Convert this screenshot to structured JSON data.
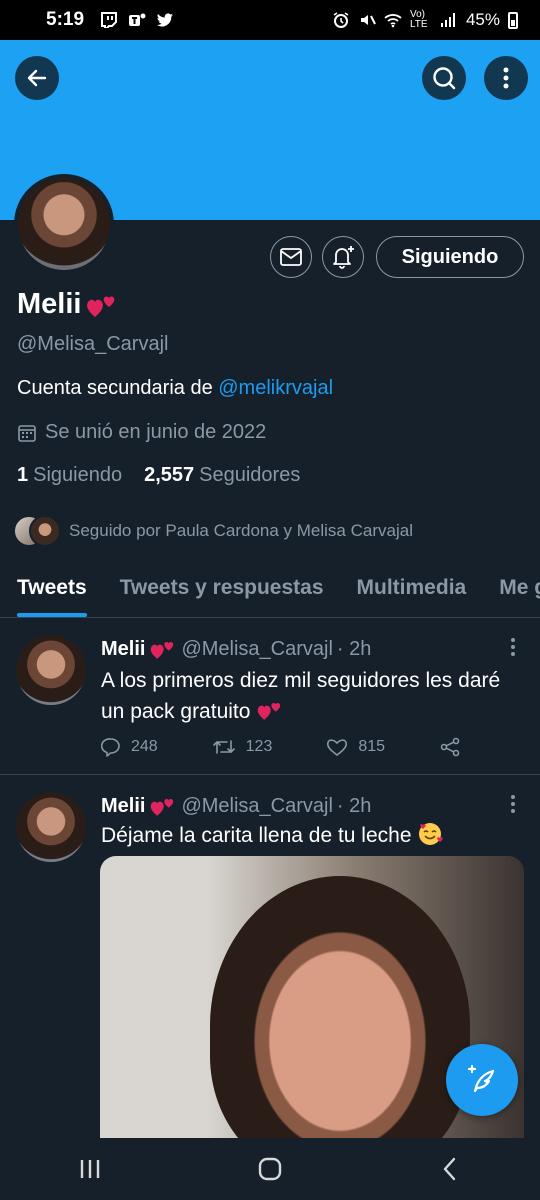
{
  "status_bar": {
    "time": "5:19",
    "battery": "45%",
    "network": "Vo) LTE"
  },
  "profile": {
    "display_name": "Melii",
    "handle": "@Melisa_Carvajl",
    "bio_prefix": "Cuenta secundaria de ",
    "bio_link": "@melikrvajal",
    "joined": "Se unió en junio de 2022",
    "following_count": "1",
    "following_label": "Siguiendo",
    "followers_count": "2,557",
    "followers_label": "Seguidores",
    "followed_by": "Seguido por Paula Cardona y Melisa Carvajal",
    "follow_button": "Siguiendo"
  },
  "tabs": [
    {
      "label": "Tweets",
      "active": true
    },
    {
      "label": "Tweets y respuestas",
      "active": false
    },
    {
      "label": "Multimedia",
      "active": false
    },
    {
      "label": "Me gusta",
      "active": false
    }
  ],
  "tweets": [
    {
      "name": "Melii",
      "handle": "@Melisa_Carvajl",
      "time": "· 2h",
      "text": "A los primeros diez mil seguidores les daré un pack gratuito",
      "replies": "248",
      "retweets": "123",
      "likes": "815"
    },
    {
      "name": "Melii",
      "handle": "@Melisa_Carvajl",
      "time": "· 2h",
      "text": "Déjame la carita llena de tu leche"
    }
  ],
  "colors": {
    "background": "#15202b",
    "banner": "#1da1f2",
    "accent": "#1d9bf0",
    "secondary_text": "#8b98a5",
    "heart_emoji": "#e0245e"
  },
  "icons": {
    "back": "arrow-left-icon",
    "search": "search-icon",
    "more": "more-vertical-icon",
    "mail": "mail-icon",
    "bell": "bell-plus-icon",
    "calendar": "calendar-icon",
    "reply": "reply-icon",
    "retweet": "retweet-icon",
    "like": "heart-icon",
    "share": "share-icon",
    "compose": "compose-tweet-icon"
  }
}
